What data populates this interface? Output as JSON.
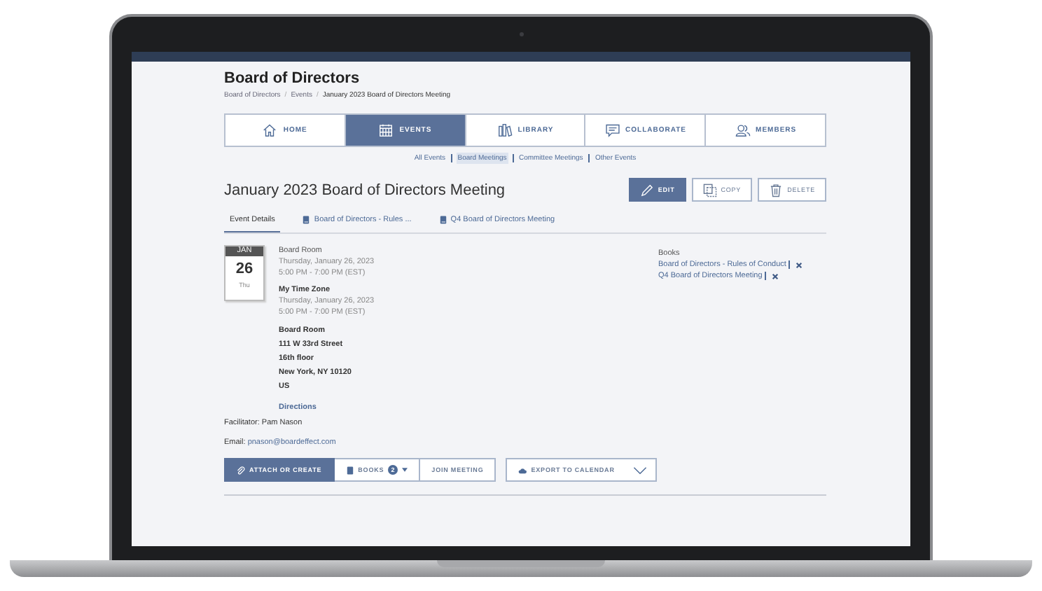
{
  "header": {
    "title": "Board of Directors",
    "breadcrumb_separator": "/",
    "breadcrumbs": [
      "Board of Directors",
      "Events",
      "January 2023 Board of Directors Meeting"
    ]
  },
  "nav_tabs": [
    {
      "label": "HOME",
      "selected": false
    },
    {
      "label": "EVENTS",
      "selected": true
    },
    {
      "label": "LIBRARY",
      "selected": false
    },
    {
      "label": "COLLABORATE",
      "selected": false
    },
    {
      "label": "MEMBERS",
      "selected": false
    }
  ],
  "sub_nav": [
    {
      "label": "All Events",
      "selected": false
    },
    {
      "label": "Board Meetings",
      "selected": true
    },
    {
      "label": "Committee Meetings",
      "selected": false
    },
    {
      "label": "Other Events",
      "selected": false
    }
  ],
  "event_title": "January 2023 Board of Directors Meeting",
  "actions": [
    {
      "label": "EDIT",
      "kind": "primary"
    },
    {
      "label": "COPY",
      "kind": "secondary"
    },
    {
      "label": "DELETE",
      "kind": "secondary"
    }
  ],
  "detail_tabs": [
    {
      "label": "Event Details",
      "kind": "plain",
      "selected": true
    },
    {
      "label": "Board of Directors - Rules ...",
      "kind": "book",
      "selected": false
    },
    {
      "label": "Q4 Board of Directors Meeting",
      "kind": "book",
      "selected": false
    }
  ],
  "date": {
    "month": "JAN",
    "day": "26",
    "weekday": "Thu"
  },
  "schedule": [
    {
      "heading": "Board Room",
      "date": "Thursday, January 26, 2023",
      "time": "5:00 PM - 7:00 PM (EST)",
      "kind": "muted"
    },
    {
      "heading": "My Time Zone",
      "date": "Thursday, January 26, 2023",
      "time": "5:00 PM - 7:00 PM (EST)",
      "kind": "bold"
    }
  ],
  "address": [
    "Board Room",
    "111 W 33rd Street",
    "16th floor",
    "New York, NY 10120",
    "US"
  ],
  "directions": "Directions",
  "books": {
    "label": "Books",
    "items": [
      "Board of Directors - Rules of Conduct",
      "Q4 Board of Directors Meeting"
    ]
  },
  "facilitator": "Facilitator: Pam Nason",
  "email": {
    "label": "Email:",
    "value": "pnason@boardeffect.com"
  },
  "toolbar": [
    {
      "label": "ATTACH OR CREATE",
      "kind": "primary"
    },
    {
      "label": "BOOKS",
      "kind": "books",
      "count": "2"
    },
    {
      "label": "JOIN MEETING",
      "kind": "plain"
    }
  ],
  "export": {
    "label": "EXPORT TO CALENDAR"
  }
}
